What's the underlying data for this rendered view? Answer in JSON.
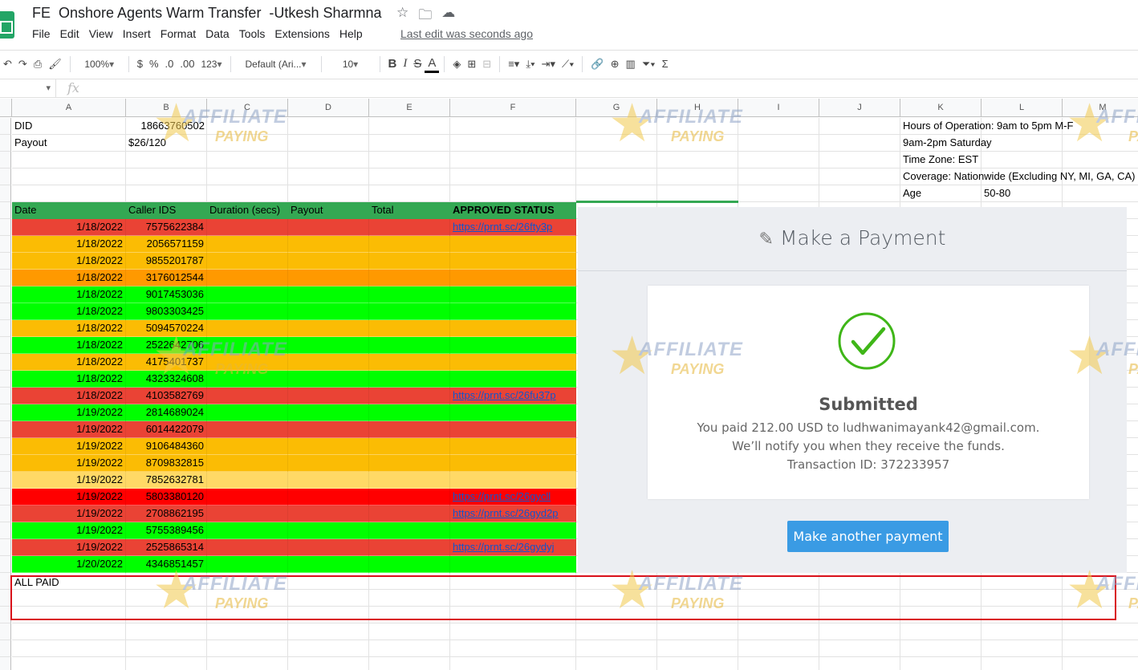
{
  "title": "FE  Onshore Agents Warm Transfer  -Utkesh Sharmna",
  "menu": [
    "File",
    "Edit",
    "View",
    "Insert",
    "Format",
    "Data",
    "Tools",
    "Extensions",
    "Help"
  ],
  "last_edit": "Last edit was seconds ago",
  "toolbar": {
    "zoom": "100%",
    "currency": "$",
    "percent": "%",
    "dec_less": ".0",
    "dec_more": ".00",
    "format_more": "123",
    "font": "Default (Ari...",
    "font_size": "10",
    "bold": "B",
    "italic": "I",
    "strike": "S",
    "text_color": "A",
    "sigma": "Σ"
  },
  "formula_bar": {
    "fx": "fx",
    "value": ""
  },
  "columns": [
    "A",
    "B",
    "C",
    "D",
    "E",
    "F",
    "G",
    "H",
    "I",
    "J",
    "K",
    "L",
    "M"
  ],
  "info_left": [
    {
      "label": "DID",
      "value": "18663760502"
    },
    {
      "label": "Payout",
      "value": "$26/120"
    }
  ],
  "info_right": [
    "Hours of Operation: 9am to 5pm M-F",
    "9am-2pm Saturday",
    "Time Zone: EST",
    "Coverage: Nationwide (Excluding NY, MI, GA, CA)"
  ],
  "age": {
    "label": "Age",
    "value": "50-80"
  },
  "table": {
    "headers": [
      "Date",
      "Caller IDS",
      "Duration (secs)",
      "Payout",
      "Total",
      "APPROVED STATUS"
    ],
    "rows": [
      {
        "date": "1/18/2022",
        "caller": "7575622384",
        "status": "https://prnt.sc/26fty3p",
        "color": "#ea4335"
      },
      {
        "date": "1/18/2022",
        "caller": "2056571159",
        "status": "",
        "color": "#fbbc04"
      },
      {
        "date": "1/18/2022",
        "caller": "9855201787",
        "status": "",
        "color": "#fbbc04"
      },
      {
        "date": "1/18/2022",
        "caller": "3176012544",
        "status": "",
        "color": "#ff9900"
      },
      {
        "date": "1/18/2022",
        "caller": "9017453036",
        "status": "",
        "color": "#00ff00"
      },
      {
        "date": "1/18/2022",
        "caller": "9803303425",
        "status": "",
        "color": "#00ff00"
      },
      {
        "date": "1/18/2022",
        "caller": "5094570224",
        "status": "",
        "color": "#fbbc04"
      },
      {
        "date": "1/18/2022",
        "caller": "2522642706",
        "status": "",
        "color": "#00ff00"
      },
      {
        "date": "1/18/2022",
        "caller": "4175401737",
        "status": "",
        "color": "#fbbc04"
      },
      {
        "date": "1/18/2022",
        "caller": "4323324608",
        "status": "",
        "color": "#00ff00"
      },
      {
        "date": "1/18/2022",
        "caller": "4103582769",
        "status": "https://prnt.sc/26fu37p",
        "color": "#ea4335"
      },
      {
        "date": "1/19/2022",
        "caller": "2814689024",
        "status": "",
        "color": "#00ff00"
      },
      {
        "date": "1/19/2022",
        "caller": "6014422079",
        "status": "",
        "color": "#ea4335"
      },
      {
        "date": "1/19/2022",
        "caller": "9106484360",
        "status": "",
        "color": "#fbbc04"
      },
      {
        "date": "1/19/2022",
        "caller": "8709832815",
        "status": "",
        "color": "#fbbc04"
      },
      {
        "date": "1/19/2022",
        "caller": "7852632781",
        "status": "",
        "color": "#ffd966"
      },
      {
        "date": "1/19/2022",
        "caller": "5803380120",
        "status": "https://prnt.sc/26gycll",
        "color": "#ff0000"
      },
      {
        "date": "1/19/2022",
        "caller": "2708862195",
        "status": "https://prnt.sc/26gyd2p",
        "color": "#ea4335"
      },
      {
        "date": "1/19/2022",
        "caller": "5755389456",
        "status": "",
        "color": "#00ff00"
      },
      {
        "date": "1/19/2022",
        "caller": "2525865314",
        "status": "https://prnt.sc/26gydyj",
        "color": "#ea4335"
      },
      {
        "date": "1/20/2022",
        "caller": "4346851457",
        "status": "",
        "color": "#00ff00"
      }
    ]
  },
  "footer_note": "ALL PAID",
  "payment": {
    "title": "Make a Payment",
    "status": "Submitted",
    "line1": "You paid 212.00 USD to ludhwanimayank42@gmail.com.",
    "line2": "We’ll notify you when they receive the funds.",
    "line3": "Transaction ID: 372233957",
    "button": "Make another payment"
  },
  "watermark": {
    "line1": "AFFILIATE",
    "line2": "PAYING"
  }
}
